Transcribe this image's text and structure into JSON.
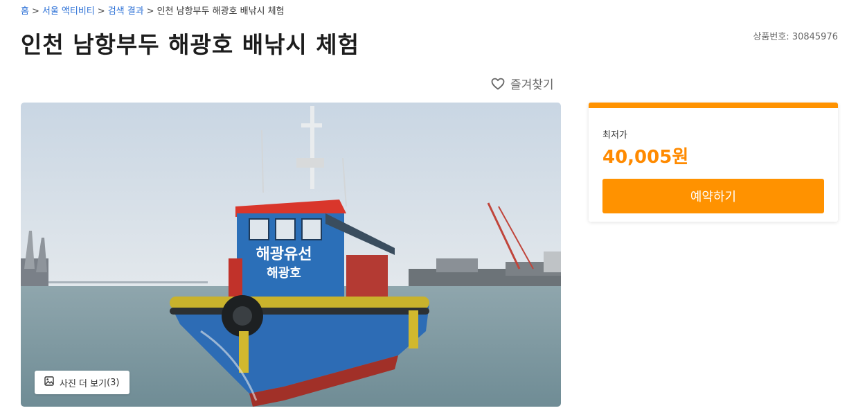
{
  "breadcrumb": {
    "home": "홈",
    "category": "서울 액티비티",
    "search": "검색 결과",
    "current": "인천 남항부두 해광호 배낚시 체험",
    "separator": ">"
  },
  "product": {
    "title": "인천 남항부두 해광호 배낚시 체험",
    "number_label": "상품번호:",
    "number": "30845976"
  },
  "favorite": {
    "label": "즐겨찾기"
  },
  "photo": {
    "more_label": "사진 더 보기",
    "count": "(3)",
    "boat_sign_main": "해광유선",
    "boat_sign_sub": "해광호"
  },
  "price_card": {
    "label": "최저가",
    "price": "40,005원",
    "reserve_label": "예약하기"
  },
  "colors": {
    "accent": "#ff9200",
    "link": "#2a6fd6"
  },
  "icons": [
    "heart-icon",
    "image-icon"
  ]
}
